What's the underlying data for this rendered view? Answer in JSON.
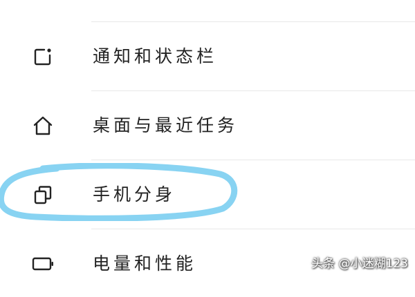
{
  "settings": {
    "items": [
      {
        "label": "通知和状态栏",
        "icon": "notification-dot-icon"
      },
      {
        "label": "桌面与最近任务",
        "icon": "home-icon"
      },
      {
        "label": "手机分身",
        "icon": "clone-icon"
      },
      {
        "label": "电量和性能",
        "icon": "battery-icon"
      }
    ]
  },
  "annotation": {
    "color": "#88d3f2",
    "highlighted_item": "手机分身"
  },
  "watermark": {
    "text": "头条 @小迷糊123"
  }
}
